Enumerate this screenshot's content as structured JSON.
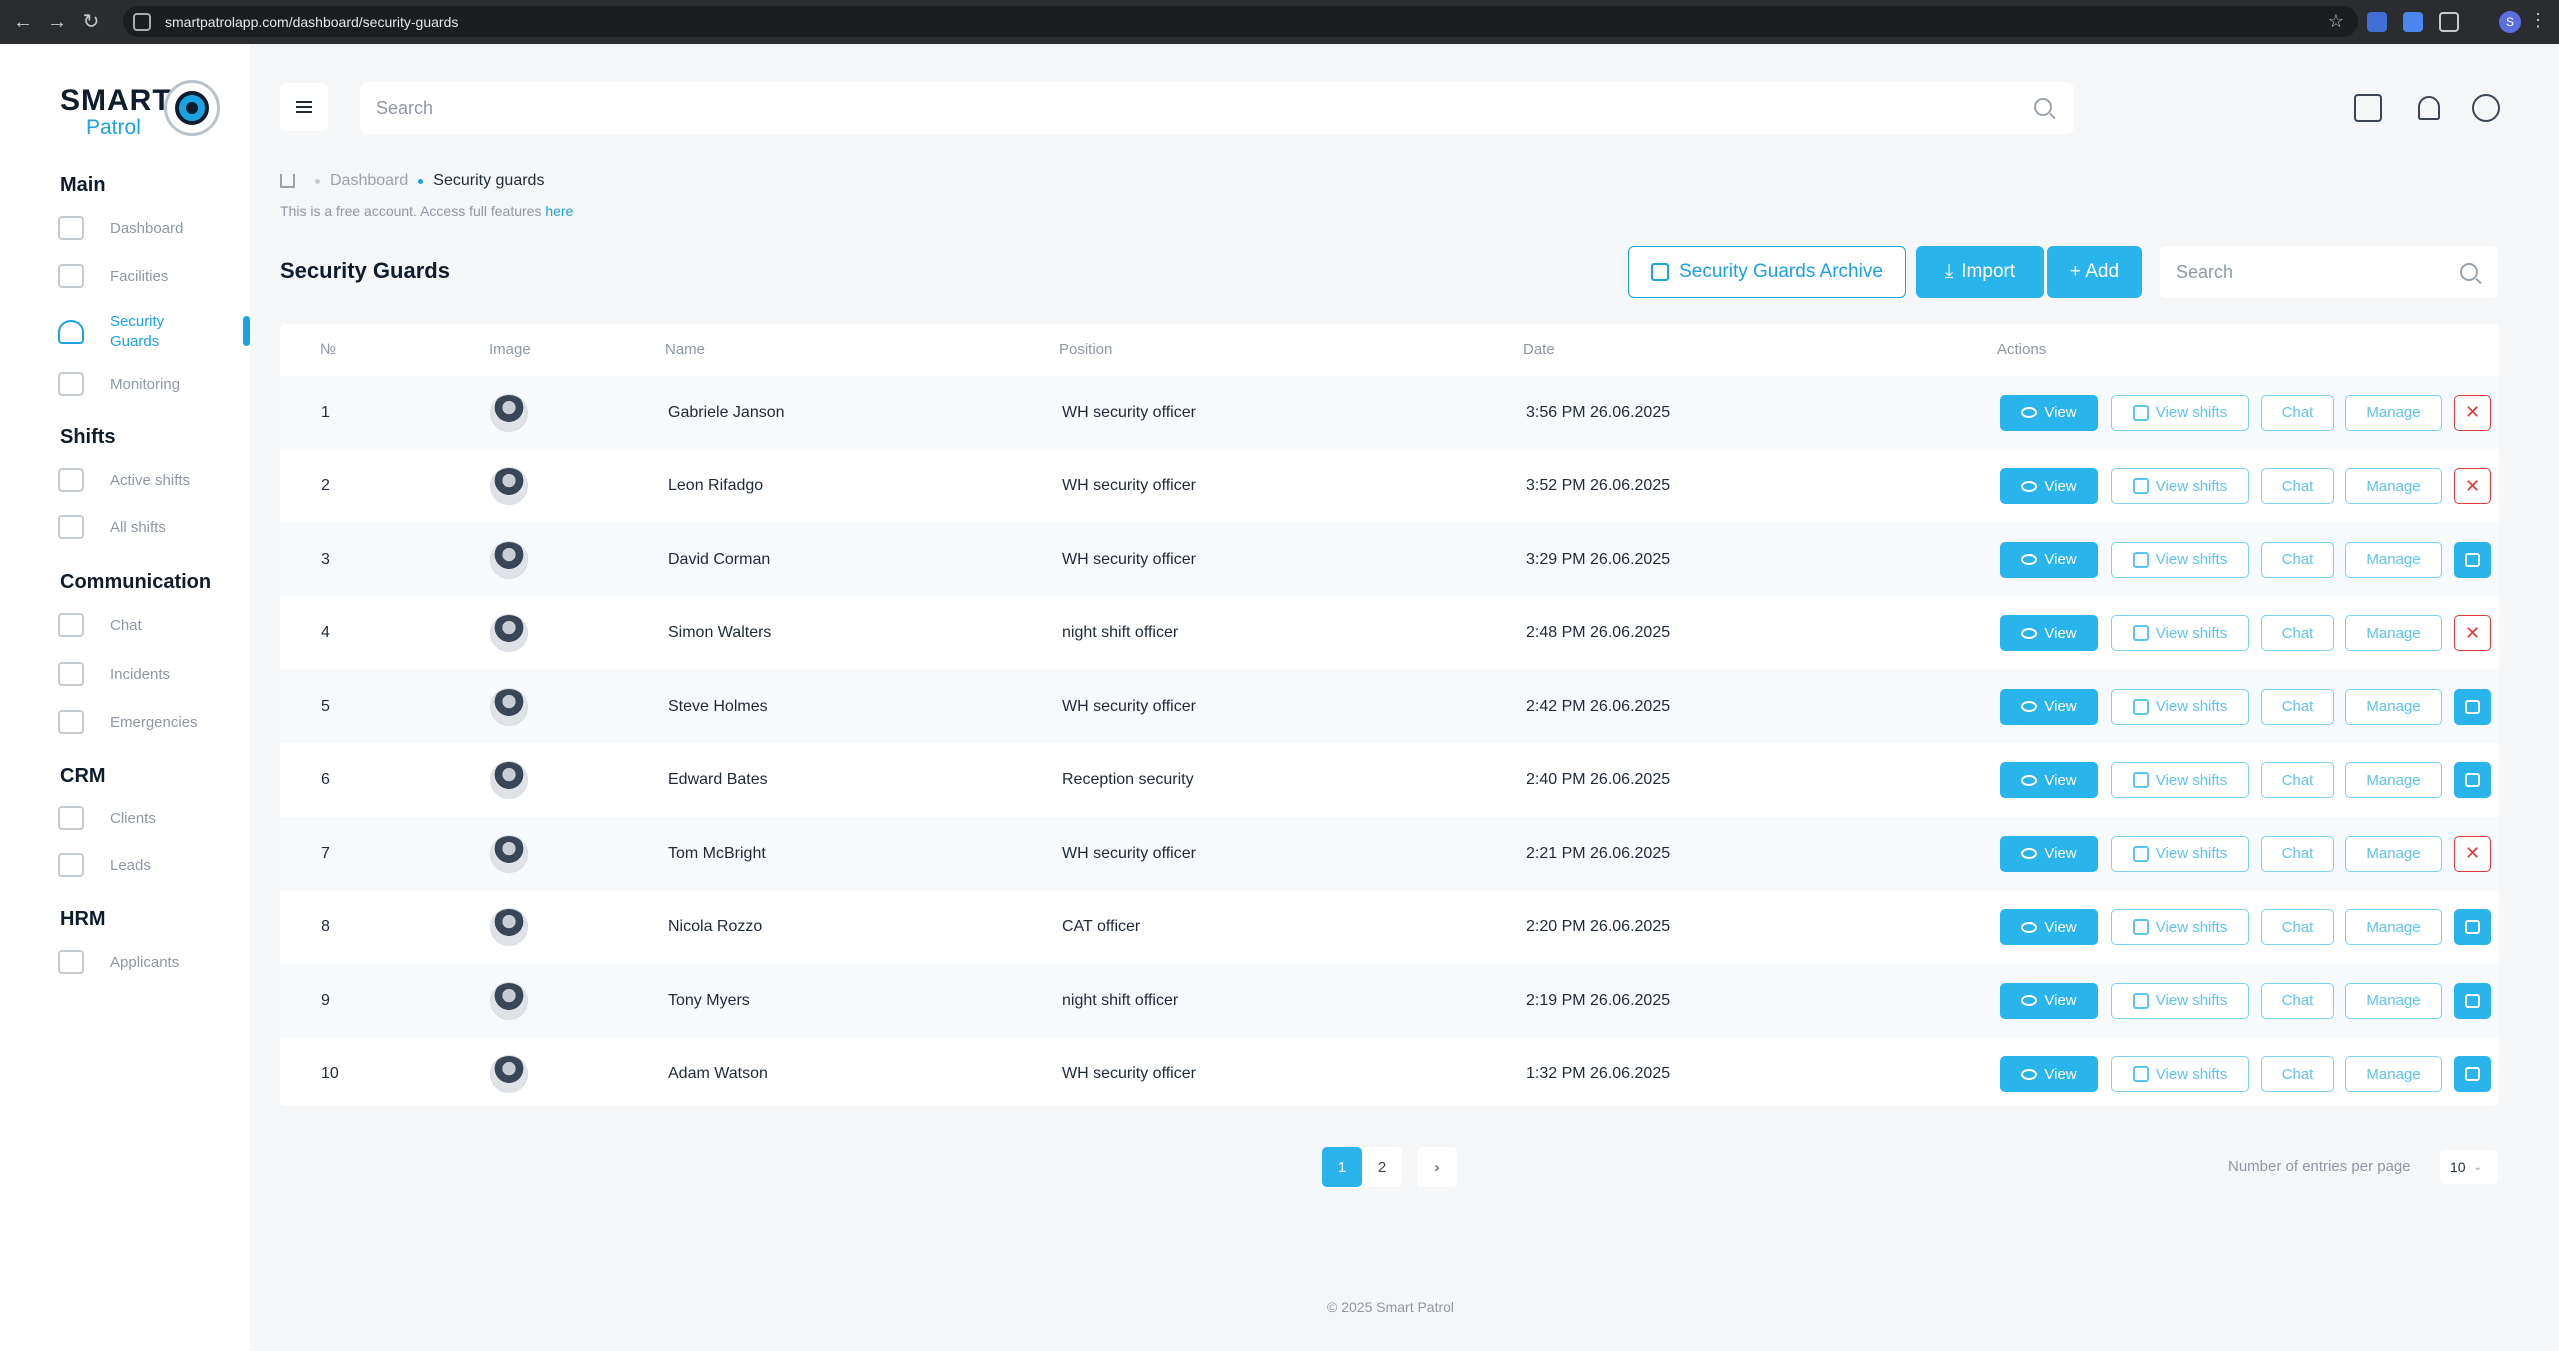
{
  "browser": {
    "url": "smartpatrolapp.com/dashboard/security-guards",
    "profile_initial": "S"
  },
  "logo": {
    "line1": "SMART",
    "line2": "Patrol"
  },
  "sidebar": {
    "sections": [
      {
        "title": "Main",
        "items": [
          {
            "label": "Dashboard",
            "icon": "grid-icon"
          },
          {
            "label": "Facilities",
            "icon": "building-icon"
          },
          {
            "label": "Security Guards",
            "icon": "guard-icon",
            "active": true
          },
          {
            "label": "Monitoring",
            "icon": "monitor-icon"
          }
        ]
      },
      {
        "title": "Shifts",
        "items": [
          {
            "label": "Active shifts",
            "icon": "hand-icon"
          },
          {
            "label": "All shifts",
            "icon": "calendar-icon"
          }
        ]
      },
      {
        "title": "Communication",
        "items": [
          {
            "label": "Chat",
            "icon": "chat-icon"
          },
          {
            "label": "Incidents",
            "icon": "incident-icon"
          },
          {
            "label": "Emergencies",
            "icon": "alarm-icon"
          }
        ]
      },
      {
        "title": "CRM",
        "items": [
          {
            "label": "Clients",
            "icon": "clients-icon"
          },
          {
            "label": "Leads",
            "icon": "leads-icon"
          }
        ]
      },
      {
        "title": "HRM",
        "items": [
          {
            "label": "Applicants",
            "icon": "applicant-icon"
          }
        ]
      }
    ],
    "active_color": "#1aa3e0"
  },
  "topbar": {
    "search_placeholder": "Search"
  },
  "breadcrumb": {
    "root": "Dashboard",
    "current": "Security guards"
  },
  "notice": {
    "text": "This is a free account. Access full features",
    "link": "here"
  },
  "page": {
    "title": "Security Guards",
    "archive_button": "Security Guards Archive",
    "import_button": "Import",
    "add_button": "+ Add",
    "search_placeholder": "Search"
  },
  "table": {
    "columns": [
      "№",
      "Image",
      "Name",
      "Position",
      "Date",
      "Actions"
    ],
    "action_labels": {
      "view": "View",
      "view_shifts": "View shifts",
      "chat": "Chat",
      "manage": "Manage"
    },
    "rows": [
      {
        "no": "1",
        "name": "Gabriele Janson",
        "position": "WH security officer",
        "date": "3:56 PM 26.06.2025",
        "last_action": "delete"
      },
      {
        "no": "2",
        "name": "Leon Rifadgo",
        "position": "WH security officer",
        "date": "3:52 PM 26.06.2025",
        "last_action": "delete"
      },
      {
        "no": "3",
        "name": "David Corman",
        "position": "WH security officer",
        "date": "3:29 PM 26.06.2025",
        "last_action": "archive"
      },
      {
        "no": "4",
        "name": "Simon Walters",
        "position": "night shift officer",
        "date": "2:48 PM 26.06.2025",
        "last_action": "delete"
      },
      {
        "no": "5",
        "name": "Steve Holmes",
        "position": "WH security officer",
        "date": "2:42 PM 26.06.2025",
        "last_action": "archive"
      },
      {
        "no": "6",
        "name": "Edward Bates",
        "position": "Reception security",
        "date": "2:40 PM 26.06.2025",
        "last_action": "archive"
      },
      {
        "no": "7",
        "name": "Tom McBright",
        "position": "WH security officer",
        "date": "2:21 PM 26.06.2025",
        "last_action": "delete"
      },
      {
        "no": "8",
        "name": "Nicola Rozzo",
        "position": "CAT officer",
        "date": "2:20 PM 26.06.2025",
        "last_action": "archive"
      },
      {
        "no": "9",
        "name": "Tony Myers",
        "position": "night shift officer",
        "date": "2:19 PM 26.06.2025",
        "last_action": "archive"
      },
      {
        "no": "10",
        "name": "Adam Watson",
        "position": "WH security officer",
        "date": "1:32 PM 26.06.2025",
        "last_action": "archive"
      }
    ]
  },
  "pagination": {
    "pages": [
      "1",
      "2"
    ],
    "current": "1",
    "entries_label": "Number of entries per page",
    "per_page": "10"
  },
  "footer": {
    "text": "© 2025 Smart Patrol"
  },
  "colors": {
    "accent": "#2ab4ec",
    "danger": "#e03a3a"
  }
}
